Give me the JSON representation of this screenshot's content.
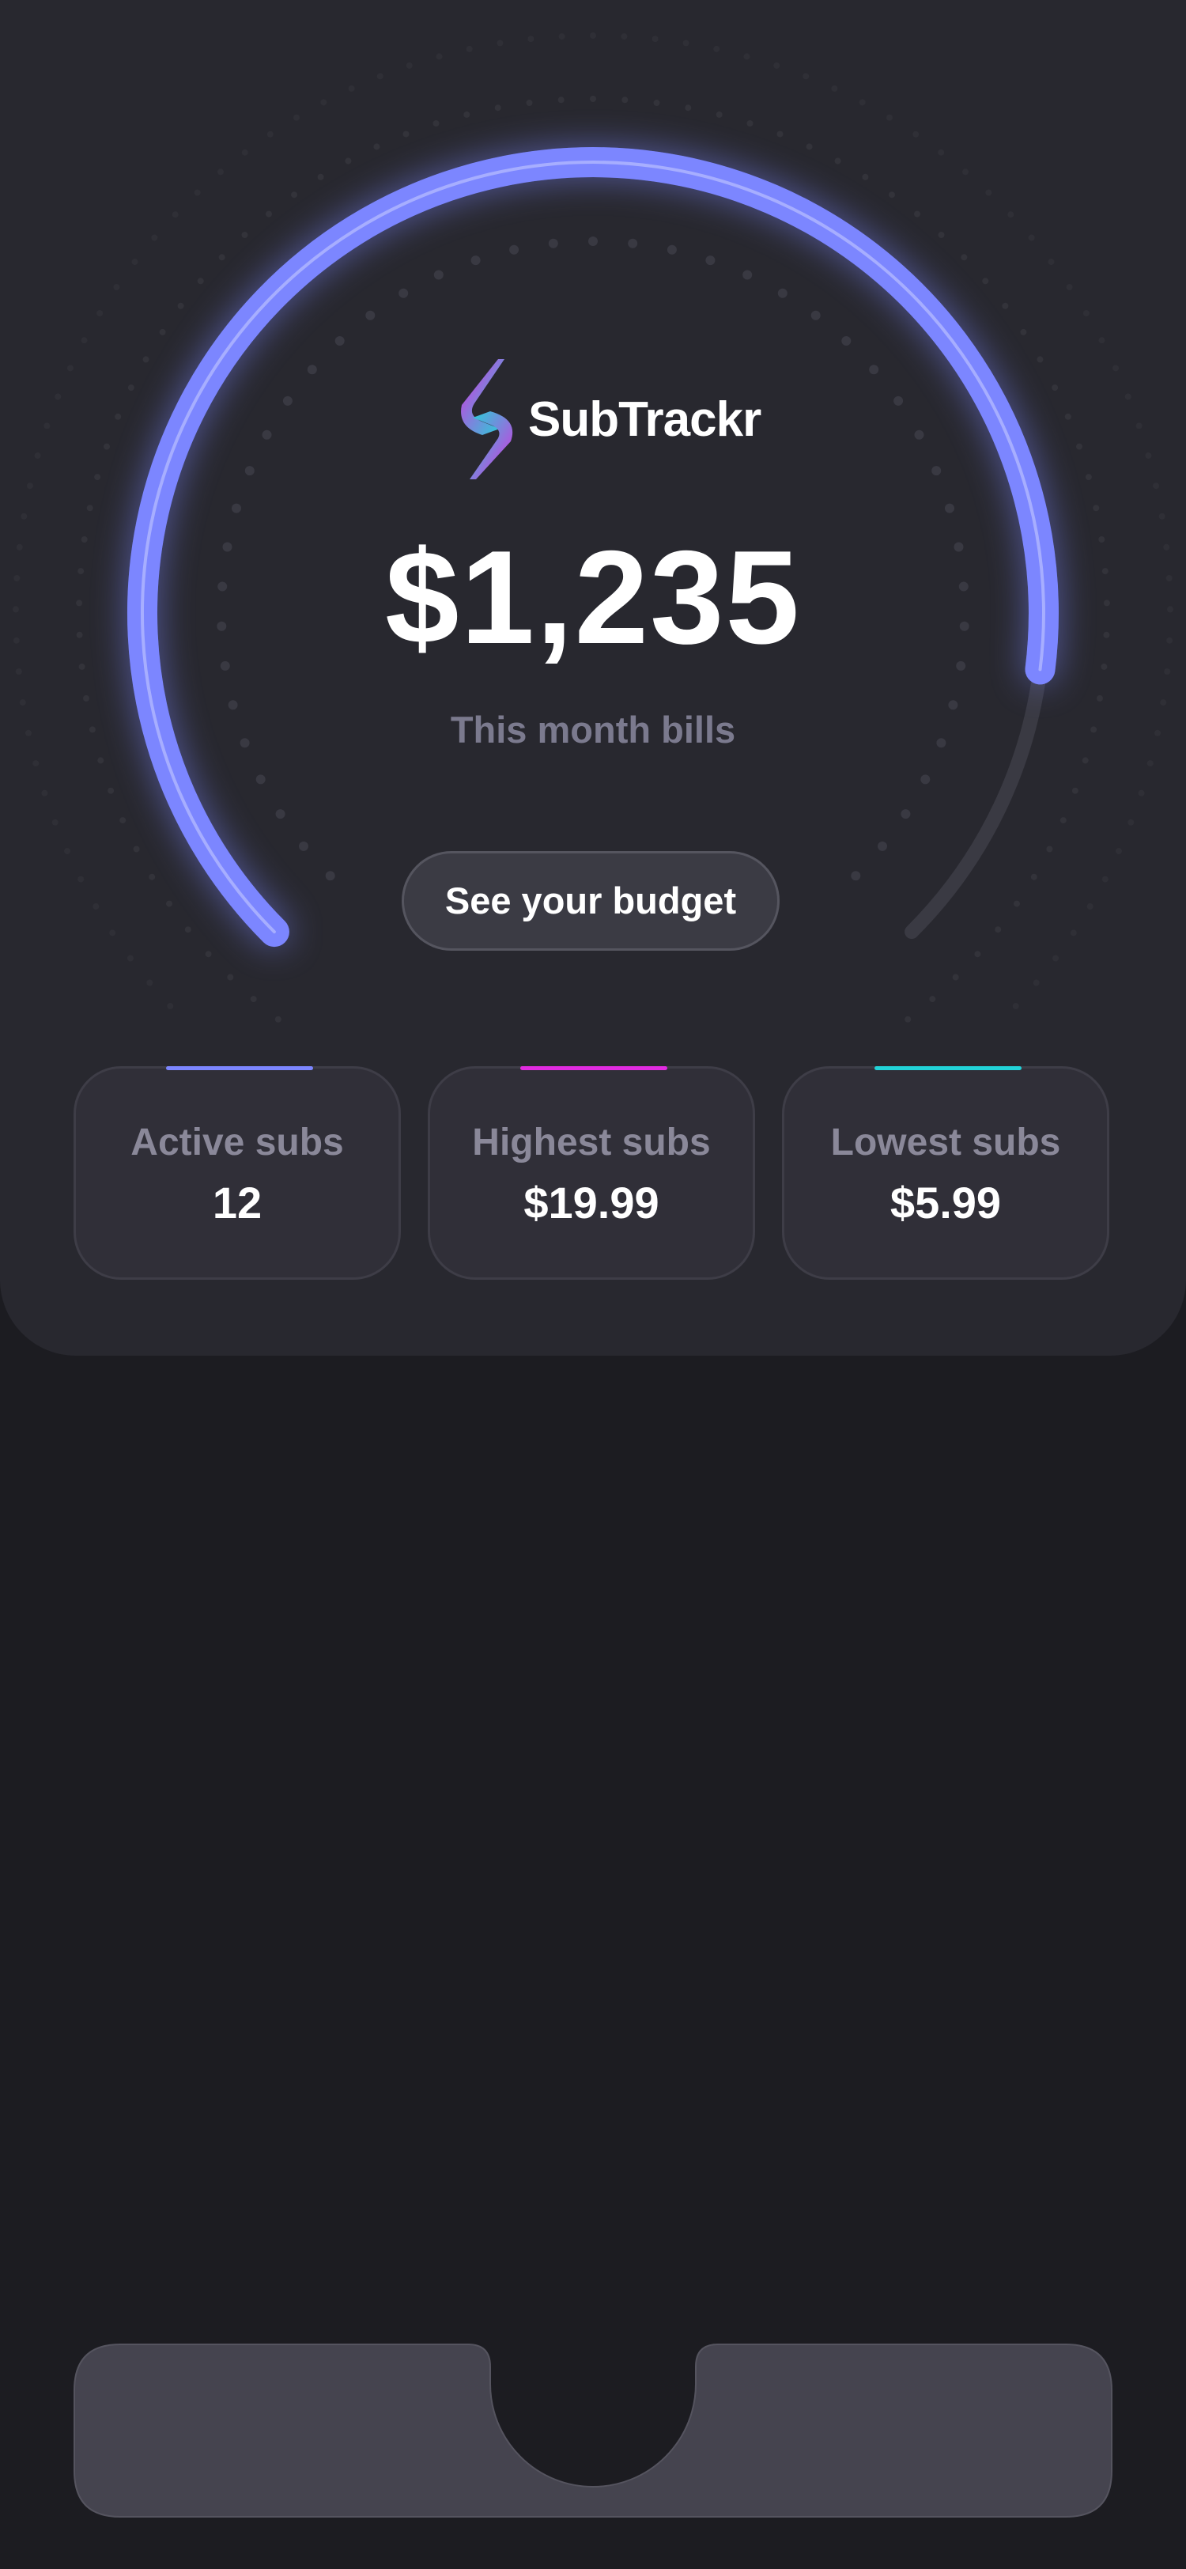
{
  "app": {
    "name": "SubTrackr"
  },
  "summary": {
    "amount": "$1,235",
    "caption": "This month bills",
    "budget_button_label": "See your budget",
    "gauge_progress_fraction": 0.86
  },
  "cards": [
    {
      "label": "Active subs",
      "value": "12",
      "accent_color": "#7c86ff"
    },
    {
      "label": "Highest subs",
      "value": "$19.99",
      "accent_color": "#e12be0"
    },
    {
      "label": "Lowest subs",
      "value": "$5.99",
      "accent_color": "#22d3d8"
    }
  ],
  "colors": {
    "gauge_accent": "#7c86ff",
    "panel_bg": "#28282f",
    "page_bg": "#1c1c21",
    "tabbar_bg": "#45444f"
  },
  "icons": {
    "logo": "subtrackr-logo-icon"
  }
}
